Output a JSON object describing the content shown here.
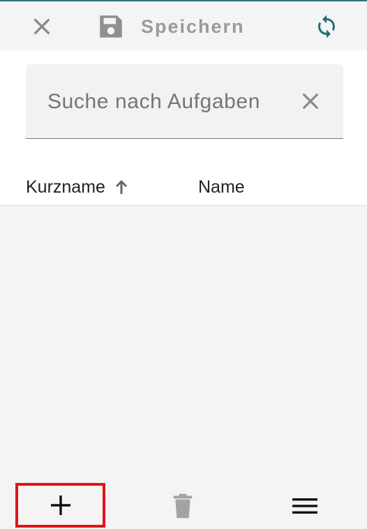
{
  "toolbar": {
    "close_icon": "close-icon",
    "save_icon": "save-icon",
    "save_label": "Speichern",
    "sync_icon": "sync-icon",
    "accent_color": "#2f6f78",
    "sync_color": "#1f6f78"
  },
  "search": {
    "placeholder": "Suche nach Aufgaben",
    "value": "",
    "clear_icon": "close-icon"
  },
  "table": {
    "columns": [
      {
        "label": "Kurzname",
        "sort": "ascending"
      },
      {
        "label": "Name"
      }
    ],
    "rows": []
  },
  "bottom_bar": {
    "add_icon": "plus-icon",
    "add_highlight_color": "#e0141c",
    "delete_icon": "trash-icon",
    "menu_icon": "hamburger-menu-icon"
  }
}
